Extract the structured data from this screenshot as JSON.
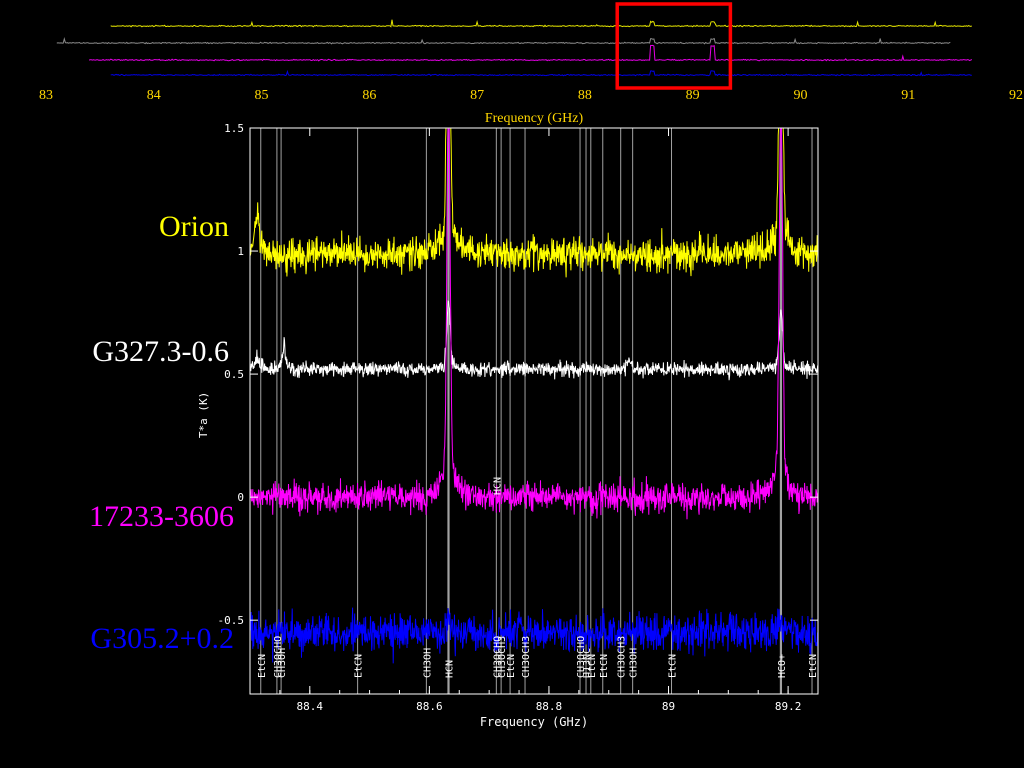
{
  "colors": {
    "background": "#000000",
    "orion": "#ffff00",
    "g327": "#ffffff",
    "src17233": "#ff00ff",
    "g305": "#0000ff",
    "overview_axis": "#ffd700",
    "highlight_box": "#ff0000",
    "main_axis": "#ffffff",
    "line_marker": "#bfbfbf"
  },
  "chart_data": [
    {
      "type": "line",
      "xlabel": "Frequency (GHz)",
      "xlim": [
        83,
        92
      ],
      "x_ticks": [
        "83",
        "84",
        "85",
        "86",
        "87",
        "88",
        "89",
        "90",
        "91",
        "92"
      ],
      "highlight_range": [
        88.3,
        89.35
      ],
      "series": [
        {
          "color": "#ffff00",
          "x_range": [
            83.6,
            91.6
          ],
          "offset": 3
        },
        {
          "color": "#9a9a9a",
          "x_range": [
            83.1,
            91.4
          ],
          "offset": 2
        },
        {
          "color": "#ff00ff",
          "x_range": [
            83.4,
            91.6
          ],
          "offset": 1
        },
        {
          "color": "#0000ff",
          "x_range": [
            83.6,
            91.6
          ],
          "offset": 0
        }
      ]
    },
    {
      "type": "line",
      "xlabel": "Frequency (GHz)",
      "xlim": [
        88.3,
        89.25
      ],
      "ylim": [
        -0.8,
        1.5
      ],
      "x_ticks": [
        {
          "v": 88.4,
          "label": "88.4"
        },
        {
          "v": 88.6,
          "label": "88.6"
        },
        {
          "v": 88.8,
          "label": "88.8"
        },
        {
          "v": 89.0,
          "label": "89"
        },
        {
          "v": 89.2,
          "label": "89.2"
        }
      ],
      "y_ticks": [
        {
          "v": 1.5,
          "label": "1.5"
        },
        {
          "v": 1.0,
          "label": "1"
        },
        {
          "v": 0.5,
          "label": "0.5"
        },
        {
          "v": 0.0,
          "label": "0"
        },
        {
          "v": -0.5,
          "label": "-0.5"
        }
      ],
      "series": [
        {
          "name": "Orion",
          "color": "#ffff00",
          "baseline": 0.99,
          "noise": 0.07,
          "hcn_peak": 1.3,
          "hco_peak": 1.3,
          "edge_peak": 0.15
        },
        {
          "name": "G327.3-0.6",
          "color": "#ffffff",
          "baseline": 0.52,
          "noise": 0.03,
          "hcn_peak": 0.25,
          "hco_peak": 0.2,
          "edge_peak": 0.05
        },
        {
          "name": "17233-3606",
          "color": "#ff00ff",
          "baseline": 0.0,
          "noise": 0.06,
          "hcn_peak": 1.45,
          "hco_peak": 1.45,
          "edge_peak": 0.0
        },
        {
          "name": "G305.2+0.2",
          "color": "#0000ff",
          "baseline": -0.55,
          "noise": 0.08,
          "hcn_peak": 0.05,
          "hco_peak": 0.05,
          "edge_peak": 0.0
        }
      ],
      "markers": [
        {
          "freq": 88.318,
          "label": "EtCN"
        },
        {
          "freq": 88.345,
          "label": "CH3OCHO"
        },
        {
          "freq": 88.352,
          "label": "CH3OH"
        },
        {
          "freq": 88.48,
          "label": "EtCN"
        },
        {
          "freq": 88.595,
          "label": "CH3OH"
        },
        {
          "freq": 88.632,
          "label": "HCN"
        },
        {
          "freq": 88.712,
          "label": "CH3OCHO"
        },
        {
          "freq": 88.72,
          "label": "CH3OCH3"
        },
        {
          "freq": 88.735,
          "label": "EtCN"
        },
        {
          "freq": 88.76,
          "label": "CH3OCH3"
        },
        {
          "freq": 88.852,
          "label": "CH3OCHO"
        },
        {
          "freq": 88.862,
          "label": "H13NC"
        },
        {
          "freq": 88.87,
          "label": "EtCN"
        },
        {
          "freq": 88.89,
          "label": "EtCN"
        },
        {
          "freq": 88.92,
          "label": "CH3OCH3"
        },
        {
          "freq": 88.94,
          "label": "CH3OH"
        },
        {
          "freq": 89.005,
          "label": "EtCN"
        },
        {
          "freq": 89.188,
          "label": "HCO+"
        },
        {
          "freq": 89.24,
          "label": "EtCN"
        }
      ],
      "inline_labels": [
        {
          "freq": 88.712,
          "label": "HCN"
        }
      ]
    }
  ],
  "labels": {
    "main_ylabel": "T*a (K)"
  }
}
